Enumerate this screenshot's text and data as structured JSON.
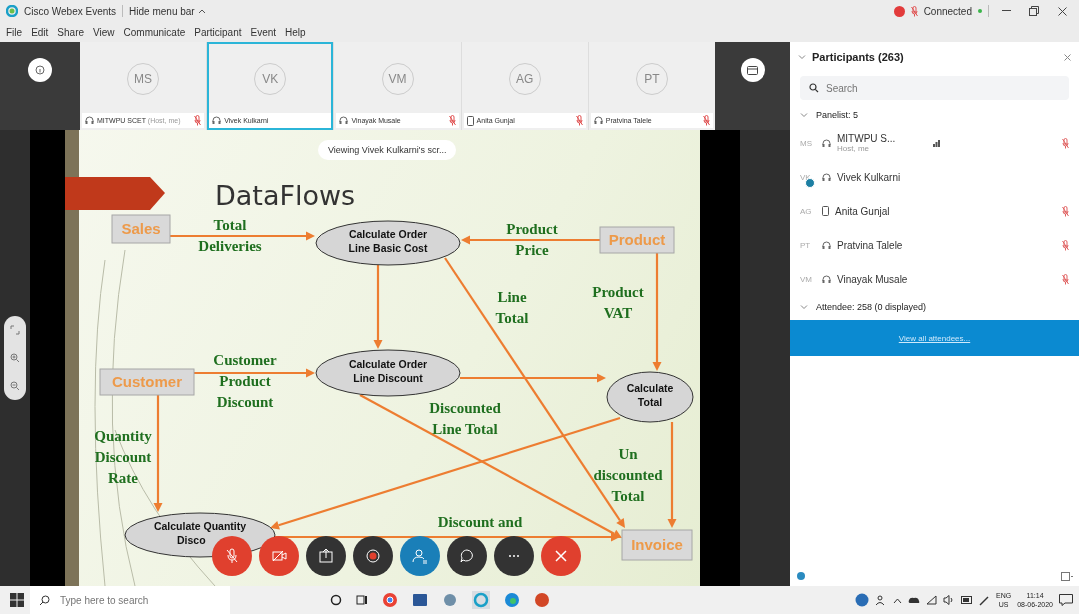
{
  "window": {
    "title": "Cisco Webex Events",
    "menu_toggle": "Hide menu bar",
    "status": "Connected",
    "recording": true
  },
  "menu": [
    "File",
    "Edit",
    "Share",
    "View",
    "Communicate",
    "Participant",
    "Event",
    "Help"
  ],
  "thumbnails": [
    {
      "initials": "MS",
      "name": "MITWPU SCET",
      "note": "(Host, me)",
      "kind": "headset",
      "muted": true,
      "selected": false
    },
    {
      "initials": "VK",
      "name": "Vivek Kulkarni",
      "kind": "headset",
      "muted": false,
      "selected": true
    },
    {
      "initials": "VM",
      "name": "Vinayak Musale",
      "kind": "headset",
      "muted": true,
      "selected": false
    },
    {
      "initials": "AG",
      "name": "Anita Gunjal",
      "kind": "phone",
      "muted": true,
      "selected": false
    },
    {
      "initials": "PT",
      "name": "Pratvina Talele",
      "kind": "headset",
      "muted": true,
      "selected": false
    }
  ],
  "viewing_banner": "Viewing Vivek Kulkarni's scr...",
  "slide": {
    "title": "DataFlows",
    "nodes": [
      {
        "kind": "box",
        "lines": [
          "Sales"
        ]
      },
      {
        "kind": "ellipse",
        "lines": [
          "Calculate Order",
          "Line Basic Cost"
        ]
      },
      {
        "kind": "box",
        "lines": [
          "Product"
        ]
      },
      {
        "kind": "box",
        "lines": [
          "Customer"
        ]
      },
      {
        "kind": "ellipse",
        "lines": [
          "Calculate Order",
          "Line Discount"
        ]
      },
      {
        "kind": "ellipse",
        "lines": [
          "Calculate",
          "Total"
        ]
      },
      {
        "kind": "ellipse",
        "lines": [
          "Calculate Quantity",
          "Disco"
        ]
      },
      {
        "kind": "box",
        "lines": [
          "Invoice"
        ]
      }
    ],
    "flow_labels": [
      {
        "lines": [
          "Total",
          "Deliveries"
        ]
      },
      {
        "lines": [
          "Product",
          "Price"
        ]
      },
      {
        "lines": [
          "Line",
          "Total"
        ]
      },
      {
        "lines": [
          "Product",
          "VAT"
        ]
      },
      {
        "lines": [
          "Customer",
          "Product",
          "Discount"
        ]
      },
      {
        "lines": [
          "Discounted",
          "Line Total"
        ]
      },
      {
        "lines": [
          "Quantity",
          "Discount",
          "Rate"
        ]
      },
      {
        "lines": [
          "Un",
          "discounted",
          "Total"
        ]
      },
      {
        "lines": [
          "Discount and"
        ]
      }
    ]
  },
  "call_controls": [
    {
      "kind": "mute"
    },
    {
      "kind": "video"
    },
    {
      "kind": "share"
    },
    {
      "kind": "record"
    },
    {
      "kind": "participants"
    },
    {
      "kind": "chat"
    },
    {
      "kind": "more"
    },
    {
      "kind": "end"
    }
  ],
  "participants": {
    "title": "Participants (263)",
    "expanded": true,
    "search": {
      "placeholder": "Search"
    },
    "panelist_header": {
      "label": "Panelist: 5",
      "expanded": true
    },
    "panelists": [
      {
        "initials": "MS",
        "name": "MITWPU S...",
        "subtitle": "Host, me",
        "kind": "headset",
        "presenting": false,
        "signal": true,
        "muted": true
      },
      {
        "initials": "VK",
        "name": "Vivek Kulkarni",
        "kind": "headset",
        "presenting": true,
        "signal": false,
        "muted": false
      },
      {
        "initials": "AG",
        "name": "Anita Gunjal",
        "kind": "phone",
        "presenting": false,
        "signal": false,
        "muted": true
      },
      {
        "initials": "PT",
        "name": "Pratvina Talele",
        "kind": "headset",
        "presenting": false,
        "signal": false,
        "muted": true
      },
      {
        "initials": "VM",
        "name": "Vinayak Musale",
        "kind": "headset",
        "presenting": false,
        "signal": false,
        "muted": true
      }
    ],
    "attendee_header": {
      "label": "Attendee: 258 (0 displayed)",
      "expanded": true
    },
    "view_all_link": "View all attendees..."
  },
  "taskbar": {
    "search": {
      "placeholder": "Type here to search"
    },
    "language": "ENG",
    "region": "US",
    "time": "11:14",
    "date": "08-06-2020"
  }
}
